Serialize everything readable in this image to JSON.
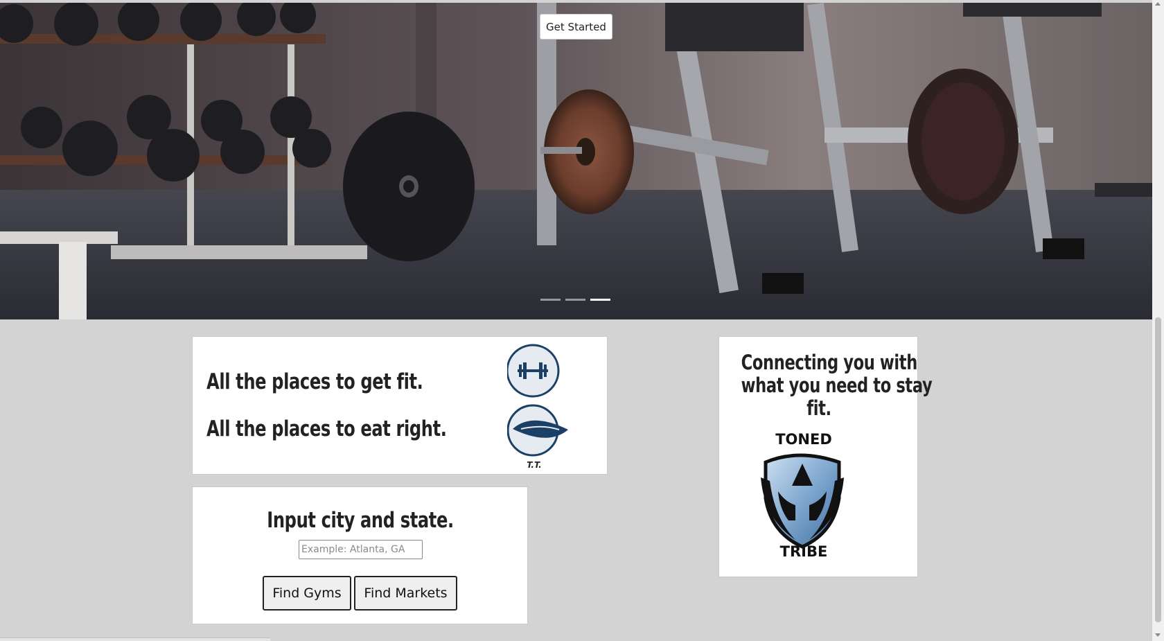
{
  "hero": {
    "cta_label": "Get Started",
    "slides": [
      {
        "active": false
      },
      {
        "active": false
      },
      {
        "active": true
      }
    ]
  },
  "features": {
    "line1": "All the places to get fit.",
    "line2": "All the places to eat right.",
    "logo_caption": "T.T."
  },
  "search": {
    "heading": "Input city and state.",
    "placeholder": "Example: Atlanta, GA",
    "value": "",
    "find_gyms_label": "Find Gyms",
    "find_markets_label": "Find Markets"
  },
  "tagline": {
    "line1": "Connecting you with",
    "line2": "what you need to stay",
    "line3": "fit.",
    "brand_top": "TONED",
    "brand_bottom": "TRIBE"
  },
  "colors": {
    "page_bg": "#d3d3d3",
    "icon_navy": "#1c3f66",
    "shield_blue": "#7fa7cf"
  }
}
